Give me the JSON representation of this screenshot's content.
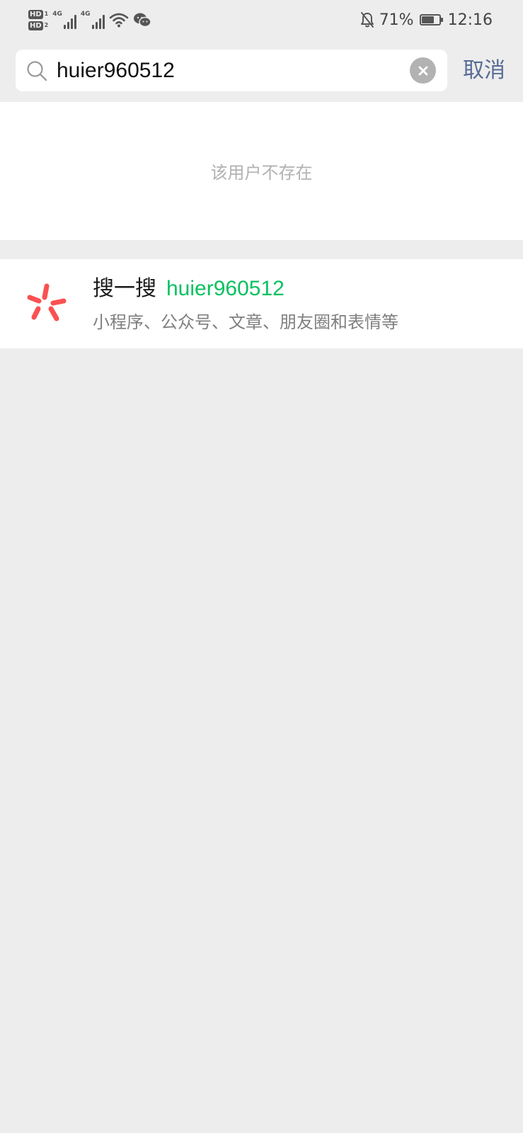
{
  "status_bar": {
    "hd1": "HD",
    "hd1_sim": "1",
    "hd2": "HD",
    "hd2_sim": "2",
    "net1": "4G",
    "net2": "4G",
    "battery_percent": "71%",
    "battery_level": 0.71,
    "time": "12:16",
    "icons": [
      "signal-icon",
      "wifi-icon",
      "wechat-icon",
      "mute-icon",
      "battery-icon"
    ]
  },
  "search": {
    "value": "huier960512",
    "cancel_label": "取消"
  },
  "result": {
    "not_found_text": "该用户不存在"
  },
  "sou_yi_sou": {
    "prefix": "搜一搜",
    "keyword": "huier960512",
    "subtitle": "小程序、公众号、文章、朋友圈和表情等"
  },
  "colors": {
    "background": "#ededed",
    "card": "#ffffff",
    "link_blue": "#576b95",
    "keyword_green": "#07c160",
    "icon_red": "#fa5151",
    "hint_gray": "#b2b2b2"
  }
}
